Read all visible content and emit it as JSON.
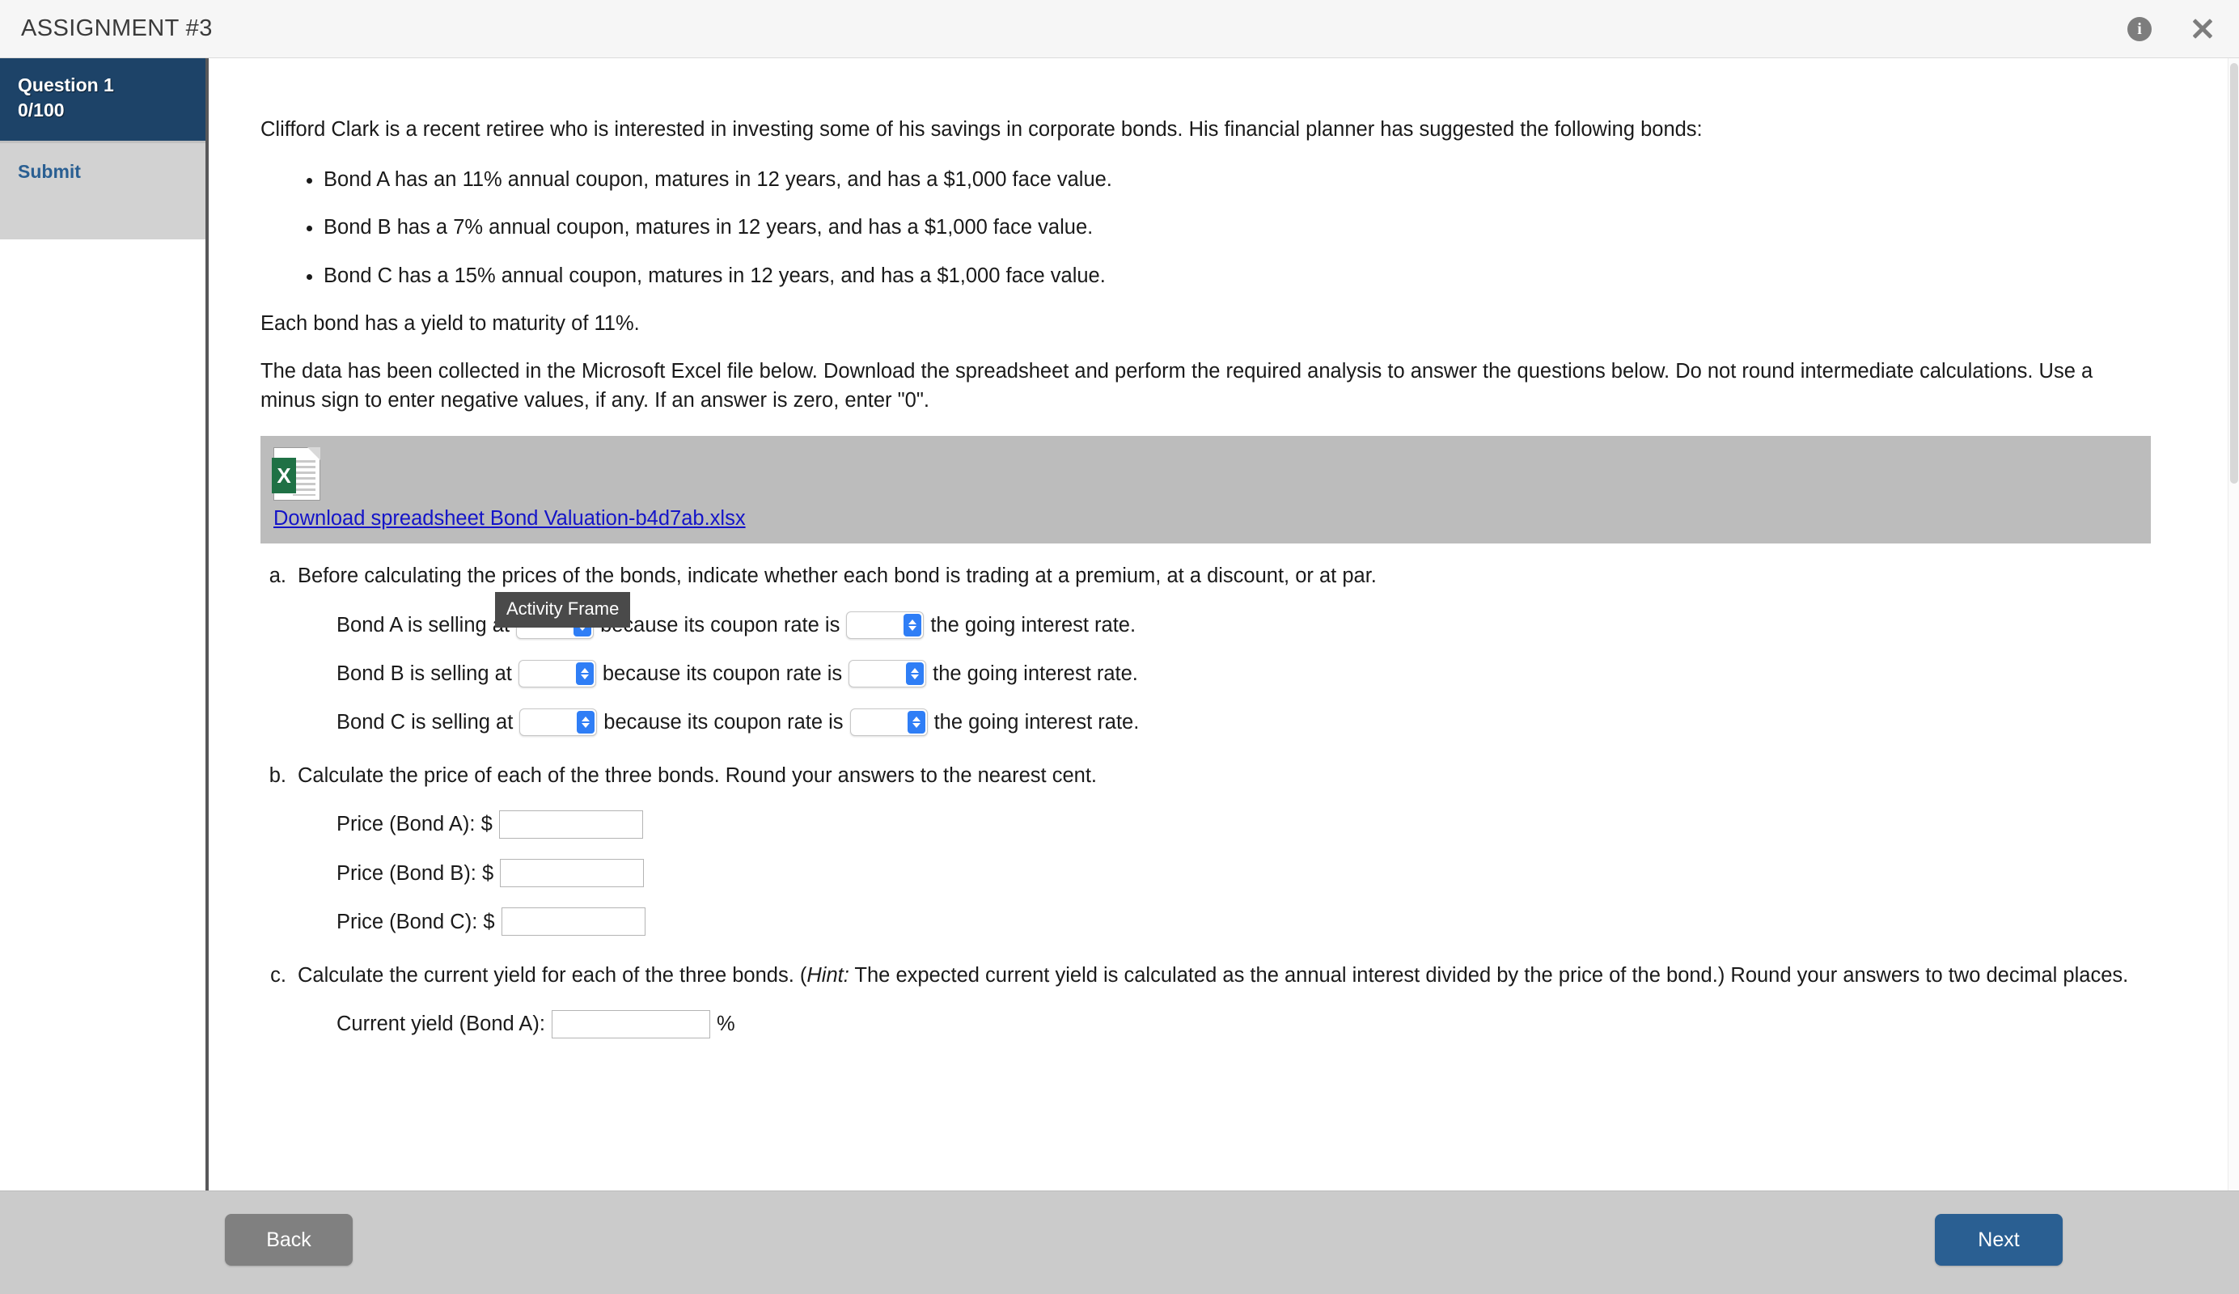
{
  "header": {
    "title": "ASSIGNMENT #3",
    "info_icon": "info-icon",
    "close_icon": "close-icon"
  },
  "sidebar": {
    "question_label": "Question 1",
    "score": "0/100",
    "submit_label": "Submit"
  },
  "content": {
    "intro": "Clifford Clark is a recent retiree who is interested in investing some of his savings in corporate bonds. His financial planner has suggested the following bonds:",
    "bullets": [
      "Bond A has an 11% annual coupon, matures in 12 years, and has a $1,000 face value.",
      "Bond B has a 7% annual coupon, matures in 12 years, and has a $1,000 face value.",
      "Bond C has a 15% annual coupon, matures in 12 years, and has a $1,000 face value."
    ],
    "yield_note": "Each bond has a yield to maturity of 11%.",
    "data_note": "The data has been collected in the Microsoft Excel file below. Download the spreadsheet and perform the required analysis to answer the questions below. Do not round intermediate calculations. Use a minus sign to enter negative values, if any. If an answer is zero, enter \"0\".",
    "attachment": {
      "icon": "excel-file-icon",
      "icon_letter": "X",
      "link_text": "Download spreadsheet Bond Valuation-b4d7ab.xlsx"
    },
    "tooltip": "Activity Frame",
    "parts": [
      {
        "label": "a.",
        "text": "Before calculating the prices of the bonds, indicate whether each bond is trading at a premium, at a discount, or at par.",
        "rows": [
          {
            "prefix": "Bond A is selling at",
            "select1_value": "",
            "middle": "because its coupon rate is",
            "select2_value": "",
            "suffix": "the going interest rate."
          },
          {
            "prefix": "Bond B is selling at",
            "select1_value": "",
            "middle": "because its coupon rate is",
            "select2_value": "",
            "suffix": "the going interest rate."
          },
          {
            "prefix": "Bond C is selling at",
            "select1_value": "",
            "middle": "because its coupon rate is",
            "select2_value": "",
            "suffix": "the going interest rate."
          }
        ]
      },
      {
        "label": "b.",
        "text": "Calculate the price of each of the three bonds. Round your answers to the nearest cent.",
        "rows": [
          {
            "prefix": "Price (Bond A): $",
            "value": ""
          },
          {
            "prefix": "Price (Bond B): $",
            "value": ""
          },
          {
            "prefix": "Price (Bond C): $",
            "value": ""
          }
        ]
      },
      {
        "label": "c.",
        "text_before_hint": "Calculate the current yield for each of the three bonds. (",
        "hint_word": "Hint:",
        "text_after_hint": " The expected current yield is calculated as the annual interest divided by the price of the bond.) Round your answers to two decimal places.",
        "rows": [
          {
            "prefix": "Current yield (Bond A):",
            "value": "",
            "suffix": "%"
          }
        ]
      }
    ]
  },
  "footer": {
    "back_label": "Back",
    "next_label": "Next"
  },
  "colors": {
    "sidebar_active": "#1d4368",
    "submit_link": "#2a5f92",
    "next_button": "#2a5f92",
    "back_button": "#808080",
    "attachment_bg": "#bcbcbc",
    "link": "#1414c8",
    "select_stepper": "#2f7ef6"
  }
}
